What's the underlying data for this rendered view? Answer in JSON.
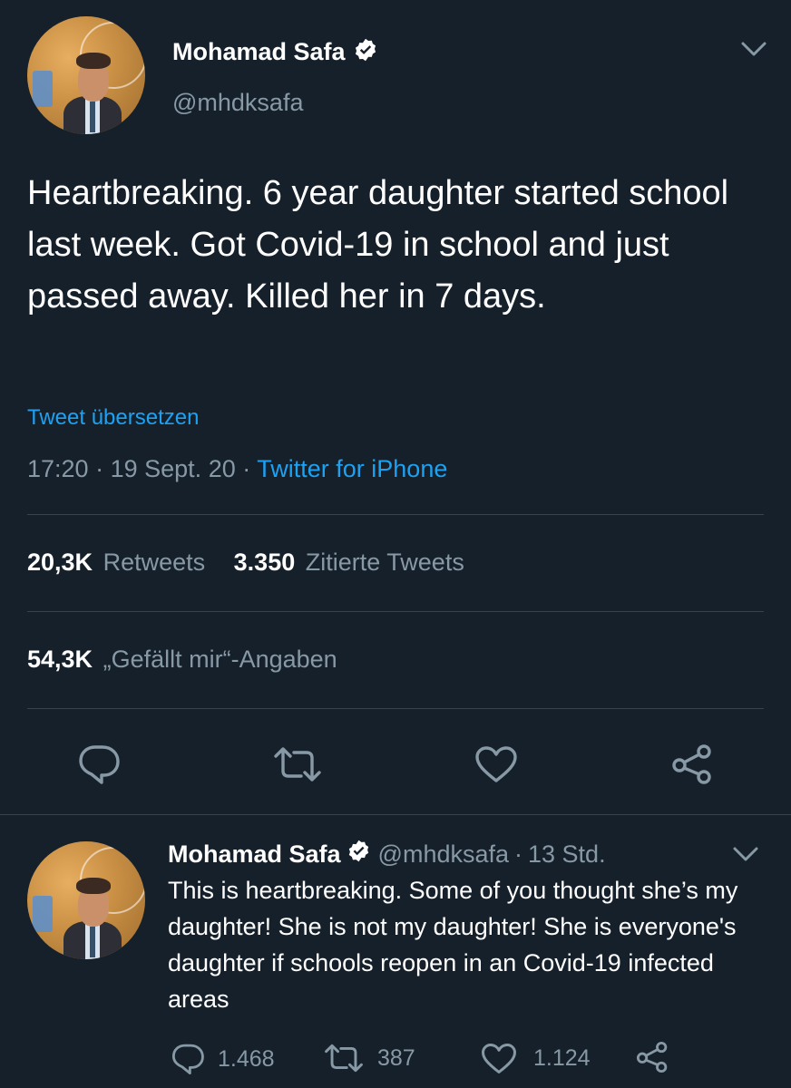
{
  "tweet": {
    "author_name": "Mohamad Safa",
    "author_handle": "@mhdksafa",
    "text": "Heartbreaking. 6 year daughter started school last week. Got Covid-19 in school and just passed away. Killed her in 7 days.",
    "translate_label": "Tweet übersetzen",
    "time": "17:20",
    "separator": "·",
    "date": "19 Sept. 20",
    "source": "Twitter for iPhone",
    "retweets_count": "20,3K",
    "retweets_label": "Retweets",
    "quotes_count": "3.350",
    "quotes_label": "Zitierte Tweets",
    "likes_count": "54,3K",
    "likes_label": "„Gefällt mir“-Angaben"
  },
  "actions": {
    "reply_icon": "reply-icon",
    "retweet_icon": "retweet-icon",
    "like_icon": "heart-icon",
    "share_icon": "share-icon"
  },
  "reply": {
    "author_name": "Mohamad Safa",
    "author_handle": "@mhdksafa",
    "separator": "·",
    "time_ago": "13 Std.",
    "text": "This is heartbreaking. Some of you thought she’s my daughter! She is not my daughter! She is everyone's daughter if schools reopen in an Covid-19 infected areas",
    "reply_count": "1.468",
    "retweet_count": "387",
    "like_count": "1.124"
  },
  "colors": {
    "background": "#15202b",
    "text": "#ffffff",
    "muted": "#8899a6",
    "accent": "#1da1f2",
    "divider": "#38444d"
  }
}
